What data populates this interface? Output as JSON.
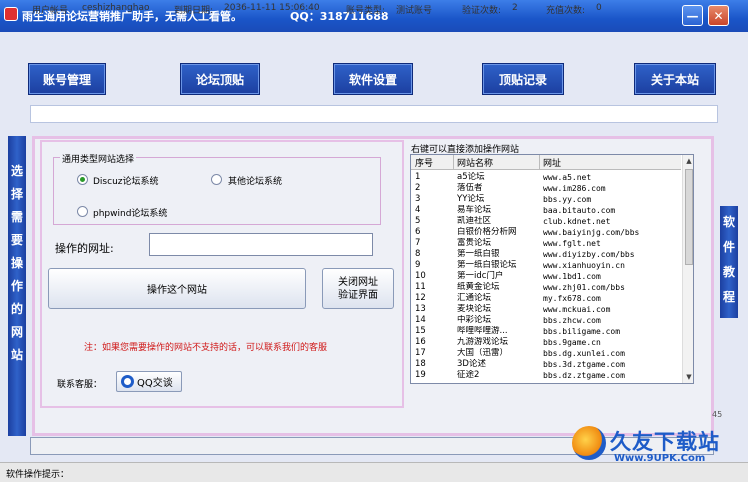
{
  "window": {
    "title": "雨生通用论坛营销推广助手，无需人工看管。",
    "qq_info": "QQ：318711688",
    "minimize_glyph": "—",
    "close_glyph": "✕"
  },
  "nav": [
    {
      "label": "账号管理"
    },
    {
      "label": "论坛顶贴"
    },
    {
      "label": "软件设置"
    },
    {
      "label": "顶贴记录"
    },
    {
      "label": "关于本站"
    }
  ],
  "info_bar": {
    "user_label": "用户帐号",
    "user_value": "ceshizhanghao",
    "expire_label": "到期日期:",
    "expire_value": "2036-11-11 15:06:40",
    "type_label": "账号类型:",
    "type_value": "测试账号",
    "verify_label": "验证次数:",
    "verify_value": "2",
    "recharge_label": "充值次数:",
    "recharge_value": "0"
  },
  "left_vertical": "选择需要操作的网站",
  "right_vertical": "软件教程",
  "site_type": {
    "group_title": "通用类型网站选择",
    "options": [
      {
        "label": "Discuz论坛系统",
        "selected": true
      },
      {
        "label": "其他论坛系统",
        "selected": false
      },
      {
        "label": "phpwind论坛系统",
        "selected": false
      }
    ]
  },
  "url_field": {
    "label": "操作的网址:",
    "value": ""
  },
  "operate_button": "操作这个网站",
  "close_verify_button": {
    "line1": "关闭网址",
    "line2": "验证界面"
  },
  "note": "注：如果您需要操作的网站不支持的话，可以联系我们的客服",
  "customer_service": {
    "label": "联系客服：",
    "qq_button": "QQ交谈"
  },
  "site_list": {
    "title": "右键可以直接添加操作网站",
    "columns": [
      "序号",
      "网站名称",
      "网址"
    ],
    "rows": [
      {
        "no": "1",
        "name": "a5论坛",
        "url": "www.a5.net"
      },
      {
        "no": "2",
        "name": "落伍者",
        "url": "www.im286.com"
      },
      {
        "no": "3",
        "name": "YY论坛",
        "url": "bbs.yy.com"
      },
      {
        "no": "4",
        "name": "易车论坛",
        "url": "baa.bitauto.com"
      },
      {
        "no": "5",
        "name": "凯迪社区",
        "url": "club.kdnet.net"
      },
      {
        "no": "6",
        "name": "白银价格分析网",
        "url": "www.baiyinjg.com/bbs"
      },
      {
        "no": "7",
        "name": "富贵论坛",
        "url": "www.fglt.net"
      },
      {
        "no": "8",
        "name": "第一纸白银",
        "url": "www.diyizby.com/bbs"
      },
      {
        "no": "9",
        "name": "第一纸白银论坛",
        "url": "www.xianhuoyin.cn"
      },
      {
        "no": "10",
        "name": "第一idc门户",
        "url": "www.1bd1.com"
      },
      {
        "no": "11",
        "name": "纸黄金论坛",
        "url": "www.zhj01.com/bbs"
      },
      {
        "no": "12",
        "name": "汇通论坛",
        "url": "my.fx678.com"
      },
      {
        "no": "13",
        "name": "麦块论坛",
        "url": "www.mckuai.com"
      },
      {
        "no": "14",
        "name": "中彩论坛",
        "url": "bbs.zhcw.com"
      },
      {
        "no": "15",
        "name": "哔哩哔哩游...",
        "url": "bbs.biligame.com"
      },
      {
        "no": "16",
        "name": "九游游戏论坛",
        "url": "bbs.9game.cn"
      },
      {
        "no": "17",
        "name": "大国（迅雷）",
        "url": "bbs.dg.xunlei.com"
      },
      {
        "no": "18",
        "name": "3D论述",
        "url": "bbs.3d.ztgame.com"
      },
      {
        "no": "19",
        "name": "征途2",
        "url": "bbs.dz.ztgame.com"
      }
    ]
  },
  "status": {
    "label": "软件操作提示：",
    "side_number": "45"
  },
  "watermark": {
    "text": "久友下载站",
    "sub": "Www.9UPK.Com"
  },
  "colors": {
    "nav_blue": "#1c3fa0",
    "note_red": "#d01818",
    "accent_border": "#e6c0e6"
  },
  "icons": [
    "app-icon",
    "qq-icon",
    "radio-selected-icon",
    "scroll-up-icon",
    "scroll-down-icon"
  ]
}
